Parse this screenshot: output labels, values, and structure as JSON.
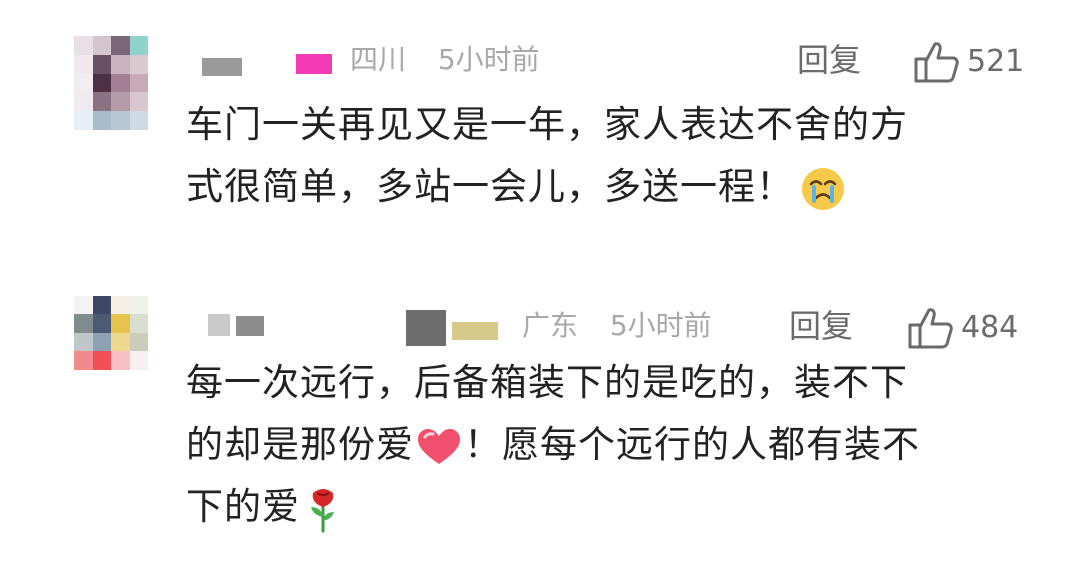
{
  "comments": [
    {
      "region": "四川",
      "time": "5小时前",
      "reply_label": "回复",
      "like_count": "521",
      "text_line1": "车门一关再见又是一年，家人表达不舍的方",
      "text_line2": "式很简单，多站一会儿，多送一程！",
      "trailing_icon": "crying-face-icon"
    },
    {
      "region": "广东",
      "time": "5小时前",
      "reply_label": "回复",
      "like_count": "484",
      "text_line1": "每一次远行，后备箱装下的是吃的，装不下",
      "text_line2_a": "的却是那份爱",
      "text_line2_b": "！愿每个远行的人都有装不",
      "text_line3": "下的爱",
      "inline_icons": [
        "heart-icon",
        "rose-icon"
      ]
    }
  ],
  "colors": {
    "text": "#222222",
    "meta": "#a8a8a8",
    "action": "#6b6b6b"
  }
}
